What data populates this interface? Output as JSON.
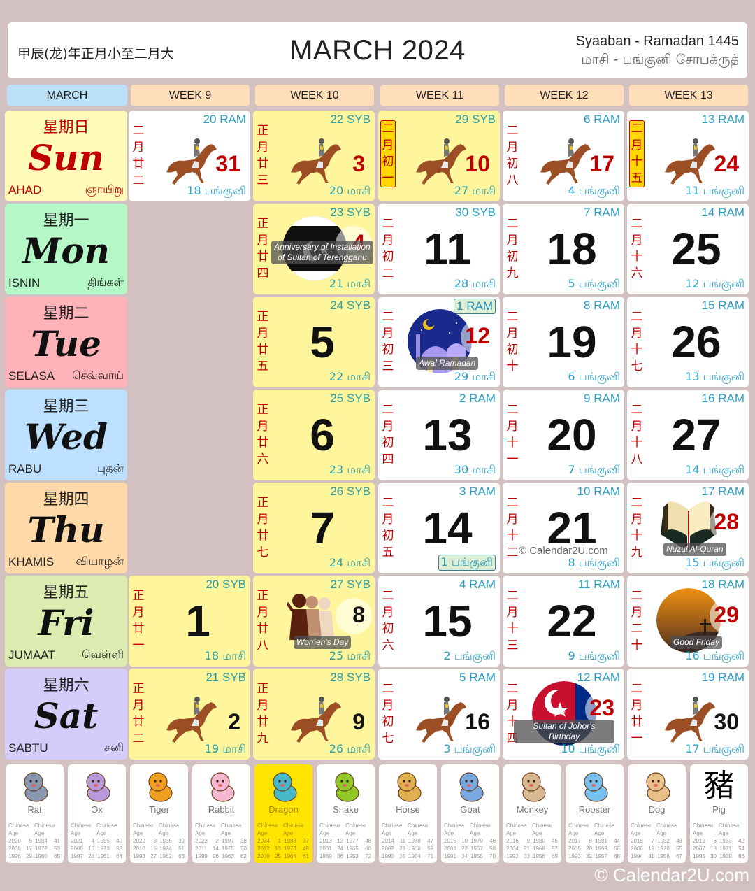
{
  "header": {
    "lunar_year": "甲辰(龙)年正月小至二月大",
    "title": "MARCH 2024",
    "hijri": "Syaaban - Ramadan 1445",
    "tamil": "மாசி - பங்குனி  சோபக்ருத்"
  },
  "week_headers": [
    "MARCH",
    "WEEK 9",
    "WEEK 10",
    "WEEK 11",
    "WEEK 12",
    "WEEK 13"
  ],
  "days": [
    {
      "zh": "星期日",
      "en": "Sun",
      "ms": "AHAD",
      "ta": "ஞாயிறு",
      "color": "#fffbb8"
    },
    {
      "zh": "星期一",
      "en": "Mon",
      "ms": "ISNIN",
      "ta": "திங்கள்",
      "color": "#b6f7c8"
    },
    {
      "zh": "星期二",
      "en": "Tue",
      "ms": "SELASA",
      "ta": "செவ்வாய்",
      "color": "#ffb3b8"
    },
    {
      "zh": "星期三",
      "en": "Wed",
      "ms": "RABU",
      "ta": "புதன்",
      "color": "#bce0fd"
    },
    {
      "zh": "星期四",
      "en": "Thu",
      "ms": "KHAMIS",
      "ta": "வியாழன்",
      "color": "#ffd9a8"
    },
    {
      "zh": "星期五",
      "en": "Fri",
      "ms": "JUMAAT",
      "ta": "வெள்ளி",
      "color": "#dcecb0"
    },
    {
      "zh": "星期六",
      "en": "Sat",
      "ms": "SABTU",
      "ta": "சனி",
      "color": "#d5cdf9"
    }
  ],
  "cells": [
    {
      "col": 1,
      "row": 0,
      "day": "31",
      "hijri": "20 RAM",
      "tamil": "18 பங்குனி",
      "chinese": "二月廿二",
      "style": "white",
      "numStyle": "red-small",
      "icon": "horse"
    },
    {
      "col": 1,
      "row": 5,
      "day": "1",
      "hijri": "20 SYB",
      "tamil": "18 மாசி",
      "chinese": "正月廿一",
      "style": "yellow",
      "numStyle": "big"
    },
    {
      "col": 1,
      "row": 6,
      "day": "2",
      "hijri": "21 SYB",
      "tamil": "19 மாசி",
      "chinese": "正月廿二",
      "style": "yellow",
      "numStyle": "small",
      "icon": "horse"
    },
    {
      "col": 2,
      "row": 0,
      "day": "3",
      "hijri": "22 SYB",
      "tamil": "20 மாசி",
      "chinese": "正月廿三",
      "style": "yellow",
      "numStyle": "red-small",
      "icon": "horse"
    },
    {
      "col": 2,
      "row": 1,
      "day": "4",
      "hijri": "23 SYB",
      "tamil": "21 மாசி",
      "chinese": "正月廿四",
      "style": "yellow",
      "numStyle": "red-hol",
      "event": "Anniversary of Installation of Sultan of Terengganu",
      "icon": "terengganu-flag"
    },
    {
      "col": 2,
      "row": 2,
      "day": "5",
      "hijri": "24 SYB",
      "tamil": "22 மாசி",
      "chinese": "正月廿五",
      "style": "yellow",
      "numStyle": "big"
    },
    {
      "col": 2,
      "row": 3,
      "day": "6",
      "hijri": "25 SYB",
      "tamil": "23 மாசி",
      "chinese": "正月廿六",
      "style": "yellow",
      "numStyle": "big"
    },
    {
      "col": 2,
      "row": 4,
      "day": "7",
      "hijri": "26 SYB",
      "tamil": "24 மாசி",
      "chinese": "正月廿七",
      "style": "yellow",
      "numStyle": "big"
    },
    {
      "col": 2,
      "row": 5,
      "day": "8",
      "hijri": "27 SYB",
      "tamil": "25 மாசி",
      "chinese": "正月廿八",
      "style": "yellow",
      "numStyle": "black-hol",
      "event": "Women's Day",
      "icon": "women"
    },
    {
      "col": 2,
      "row": 6,
      "day": "9",
      "hijri": "28 SYB",
      "tamil": "26 மாசி",
      "chinese": "正月廿九",
      "style": "yellow",
      "numStyle": "small",
      "icon": "horse"
    },
    {
      "col": 3,
      "row": 0,
      "day": "10",
      "hijri": "29 SYB",
      "tamil": "27 மாசி",
      "chinese": "二月初一",
      "chineseBox": true,
      "style": "yellow",
      "numStyle": "red-small",
      "icon": "horse"
    },
    {
      "col": 3,
      "row": 1,
      "day": "11",
      "hijri": "30 SYB",
      "tamil": "28 மாசி",
      "chinese": "二月初二",
      "style": "white",
      "numStyle": "big"
    },
    {
      "col": 3,
      "row": 2,
      "day": "12",
      "hijri": "1 RAM",
      "hijriBox": true,
      "tamil": "29 மாசி",
      "chinese": "二月初三",
      "style": "white",
      "numStyle": "red-hol",
      "event": "Awal Ramadan",
      "icon": "mosque"
    },
    {
      "col": 3,
      "row": 3,
      "day": "13",
      "hijri": "2 RAM",
      "tamil": "30 மாசி",
      "chinese": "二月初四",
      "style": "white",
      "numStyle": "big"
    },
    {
      "col": 3,
      "row": 4,
      "day": "14",
      "hijri": "3 RAM",
      "tamil": "1 பங்குனி",
      "tamilBox": true,
      "chinese": "二月初五",
      "style": "white",
      "numStyle": "big"
    },
    {
      "col": 3,
      "row": 5,
      "day": "15",
      "hijri": "4 RAM",
      "tamil": "2 பங்குனி",
      "chinese": "二月初六",
      "style": "white",
      "numStyle": "big"
    },
    {
      "col": 3,
      "row": 6,
      "day": "16",
      "hijri": "5 RAM",
      "tamil": "3 பங்குனி",
      "chinese": "二月初七",
      "style": "white",
      "numStyle": "small",
      "icon": "horse"
    },
    {
      "col": 4,
      "row": 0,
      "day": "17",
      "hijri": "6 RAM",
      "tamil": "4 பங்குனி",
      "chinese": "二月初八",
      "style": "white",
      "numStyle": "red-small",
      "icon": "horse"
    },
    {
      "col": 4,
      "row": 1,
      "day": "18",
      "hijri": "7 RAM",
      "tamil": "5 பங்குனி",
      "chinese": "二月初九",
      "style": "white",
      "numStyle": "big"
    },
    {
      "col": 4,
      "row": 2,
      "day": "19",
      "hijri": "8 RAM",
      "tamil": "6 பங்குனி",
      "chinese": "二月初十",
      "style": "white",
      "numStyle": "big"
    },
    {
      "col": 4,
      "row": 3,
      "day": "20",
      "hijri": "9 RAM",
      "tamil": "7 பங்குனி",
      "chinese": "二月十一",
      "style": "white",
      "numStyle": "big"
    },
    {
      "col": 4,
      "row": 4,
      "day": "21",
      "hijri": "10 RAM",
      "tamil": "8 பங்குனி",
      "chinese": "二月十二",
      "style": "white",
      "numStyle": "big"
    },
    {
      "col": 4,
      "row": 5,
      "day": "22",
      "hijri": "11 RAM",
      "tamil": "9 பங்குனி",
      "chinese": "二月十三",
      "style": "white",
      "numStyle": "big"
    },
    {
      "col": 4,
      "row": 6,
      "day": "23",
      "hijri": "12 RAM",
      "tamil": "10 பங்குனி",
      "chinese": "二月十四",
      "style": "white",
      "numStyle": "red-hol",
      "event": "Sultan of Johor's Birthday",
      "icon": "johor-flag"
    },
    {
      "col": 5,
      "row": 0,
      "day": "24",
      "hijri": "13 RAM",
      "tamil": "11 பங்குனி",
      "chinese": "二月十五",
      "chineseBox": true,
      "style": "white",
      "numStyle": "red-small",
      "icon": "horse"
    },
    {
      "col": 5,
      "row": 1,
      "day": "25",
      "hijri": "14 RAM",
      "tamil": "12 பங்குனி",
      "chinese": "二月十六",
      "style": "white",
      "numStyle": "big"
    },
    {
      "col": 5,
      "row": 2,
      "day": "26",
      "hijri": "15 RAM",
      "tamil": "13 பங்குனி",
      "chinese": "二月十七",
      "style": "white",
      "numStyle": "big"
    },
    {
      "col": 5,
      "row": 3,
      "day": "27",
      "hijri": "16 RAM",
      "tamil": "14 பங்குனி",
      "chinese": "二月十八",
      "style": "white",
      "numStyle": "big"
    },
    {
      "col": 5,
      "row": 4,
      "day": "28",
      "hijri": "17 RAM",
      "tamil": "15 பங்குனி",
      "chinese": "二月十九",
      "style": "white",
      "numStyle": "red-hol",
      "event": "Nuzul Al-Quran",
      "icon": "quran"
    },
    {
      "col": 5,
      "row": 5,
      "day": "29",
      "hijri": "18 RAM",
      "tamil": "16 பங்குனி",
      "chinese": "二月二十",
      "style": "white",
      "numStyle": "red-hol",
      "event": "Good Friday",
      "icon": "cross-sunset"
    },
    {
      "col": 5,
      "row": 6,
      "day": "30",
      "hijri": "19 RAM",
      "tamil": "17 பங்குனி",
      "chinese": "二月廿一",
      "style": "white",
      "numStyle": "small",
      "icon": "horse"
    }
  ],
  "watermark": "© Calendar2U.com",
  "zodiac_header": [
    "Chinese Age",
    "Chinese Age"
  ],
  "zodiac": [
    {
      "name": "Rat",
      "icon": "rat",
      "color": "#8898b0",
      "rows": [
        [
          "2020",
          "5",
          "1984",
          "41"
        ],
        [
          "2008",
          "17",
          "1972",
          "53"
        ],
        [
          "1996",
          "29",
          "1960",
          "65"
        ]
      ]
    },
    {
      "name": "Ox",
      "icon": "ox",
      "color": "#b89ad8",
      "rows": [
        [
          "2021",
          "4",
          "1985",
          "40"
        ],
        [
          "2009",
          "16",
          "1973",
          "52"
        ],
        [
          "1997",
          "28",
          "1961",
          "64"
        ]
      ]
    },
    {
      "name": "Tiger",
      "icon": "tiger",
      "color": "#f0a020",
      "rows": [
        [
          "2022",
          "3",
          "1986",
          "39"
        ],
        [
          "2010",
          "15",
          "1974",
          "51"
        ],
        [
          "1998",
          "27",
          "1962",
          "63"
        ]
      ]
    },
    {
      "name": "Rabbit",
      "icon": "rabbit",
      "color": "#f5b8d0",
      "rows": [
        [
          "2023",
          "2",
          "1987",
          "38"
        ],
        [
          "2011",
          "14",
          "1975",
          "50"
        ],
        [
          "1999",
          "26",
          "1963",
          "62"
        ]
      ]
    },
    {
      "name": "Dragon",
      "icon": "dragon",
      "color": "#48b8c8",
      "current": true,
      "rows": [
        [
          "2024",
          "1",
          "1988",
          "37"
        ],
        [
          "2012",
          "13",
          "1976",
          "49"
        ],
        [
          "2000",
          "25",
          "1964",
          "61"
        ]
      ]
    },
    {
      "name": "Snake",
      "icon": "snake",
      "color": "#90c828",
      "rows": [
        [
          "2013",
          "12",
          "1977",
          "48"
        ],
        [
          "2001",
          "24",
          "1965",
          "60"
        ],
        [
          "1989",
          "36",
          "1953",
          "72"
        ]
      ]
    },
    {
      "name": "Horse",
      "icon": "horse-zodiac",
      "color": "#e0b050",
      "rows": [
        [
          "2014",
          "11",
          "1978",
          "47"
        ],
        [
          "2002",
          "23",
          "1966",
          "59"
        ],
        [
          "1990",
          "35",
          "1954",
          "71"
        ]
      ]
    },
    {
      "name": "Goat",
      "icon": "goat",
      "color": "#78a8e0",
      "rows": [
        [
          "2015",
          "10",
          "1979",
          "46"
        ],
        [
          "2003",
          "22",
          "1967",
          "58"
        ],
        [
          "1991",
          "34",
          "1955",
          "70"
        ]
      ]
    },
    {
      "name": "Monkey",
      "icon": "monkey",
      "color": "#d8b890",
      "rows": [
        [
          "2016",
          "9",
          "1980",
          "45"
        ],
        [
          "2004",
          "21",
          "1968",
          "57"
        ],
        [
          "1992",
          "33",
          "1956",
          "69"
        ]
      ]
    },
    {
      "name": "Rooster",
      "icon": "rooster",
      "color": "#78c0f0",
      "rows": [
        [
          "2017",
          "8",
          "1981",
          "44"
        ],
        [
          "2005",
          "20",
          "1969",
          "56"
        ],
        [
          "1993",
          "32",
          "1957",
          "68"
        ]
      ]
    },
    {
      "name": "Dog",
      "icon": "dog",
      "color": "#e8c088",
      "rows": [
        [
          "2018",
          "7",
          "1982",
          "43"
        ],
        [
          "2006",
          "19",
          "1970",
          "55"
        ],
        [
          "1994",
          "31",
          "1958",
          "67"
        ]
      ]
    },
    {
      "name": "Pig",
      "icon": "pig-character",
      "glyph": "豬",
      "rows": [
        [
          "2019",
          "6",
          "1983",
          "42"
        ],
        [
          "2007",
          "18",
          "1971",
          "54"
        ],
        [
          "1995",
          "30",
          "1959",
          "66"
        ]
      ]
    }
  ],
  "copyright": "© Calendar2U.com"
}
